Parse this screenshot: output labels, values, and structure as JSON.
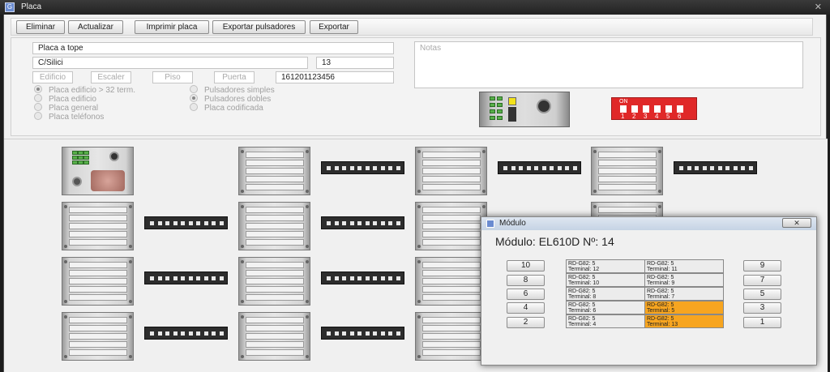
{
  "window": {
    "title": "Placa",
    "close_glyph": "✕"
  },
  "toolbar": {
    "buttons": [
      "Eliminar",
      "Actualizar",
      "Imprimir placa",
      "Exportar pulsadores",
      "Exportar"
    ]
  },
  "form": {
    "type_value": "Placa a tope",
    "street_value": "C/Silici",
    "number_value": "13",
    "edificio_placeholder": "Edificio",
    "escaler_placeholder": "Escaler",
    "piso_placeholder": "Piso",
    "puerta_placeholder": "Puerta",
    "code_value": "161201123456",
    "notes_placeholder": "Notas",
    "radios_left": [
      {
        "label": "Placa edificio > 32 term.",
        "checked": true
      },
      {
        "label": "Placa edificio",
        "checked": false
      },
      {
        "label": "Placa general",
        "checked": false
      },
      {
        "label": "Placa teléfonos",
        "checked": false
      }
    ],
    "radios_right": [
      {
        "label": "Pulsadores simples",
        "checked": false
      },
      {
        "label": "Pulsadores dobles",
        "checked": true
      },
      {
        "label": "Placa codificada",
        "checked": false
      }
    ],
    "dip_on_label": "ON",
    "dip_numbers": [
      "1",
      "2",
      "3",
      "4",
      "5",
      "6"
    ]
  },
  "dialog": {
    "title": "Módulo",
    "heading": "Módulo: EL610D Nº: 14",
    "left_buttons": [
      "10",
      "8",
      "6",
      "4",
      "2"
    ],
    "right_buttons": [
      "9",
      "7",
      "5",
      "3",
      "1"
    ],
    "close_glyph": "✕",
    "cells": [
      {
        "line1": "RD-G82: 5",
        "line2": "Terminal: 12",
        "selected": false
      },
      {
        "line1": "RD-G82: 5",
        "line2": "Terminal: 11",
        "selected": false
      },
      {
        "line1": "RD-G82: 5",
        "line2": "Terminal: 10",
        "selected": false
      },
      {
        "line1": "RD-G82: 5",
        "line2": "Terminal: 9",
        "selected": false
      },
      {
        "line1": "RD-G82: 5",
        "line2": "Terminal: 8",
        "selected": false
      },
      {
        "line1": "RD-G82: 5",
        "line2": "Terminal: 7",
        "selected": false
      },
      {
        "line1": "RD-G82: 5",
        "line2": "Terminal: 6",
        "selected": false
      },
      {
        "line1": "RD-G82: 5",
        "line2": "Terminal: 5",
        "selected": true
      },
      {
        "line1": "RD-G82: 5",
        "line2": "Terminal: 4",
        "selected": false
      },
      {
        "line1": "RD-G82: 5",
        "line2": "Terminal: 13",
        "selected": true
      }
    ]
  },
  "colors": {
    "selected_cell": "#f7a520",
    "dip_red": "#e02828"
  }
}
